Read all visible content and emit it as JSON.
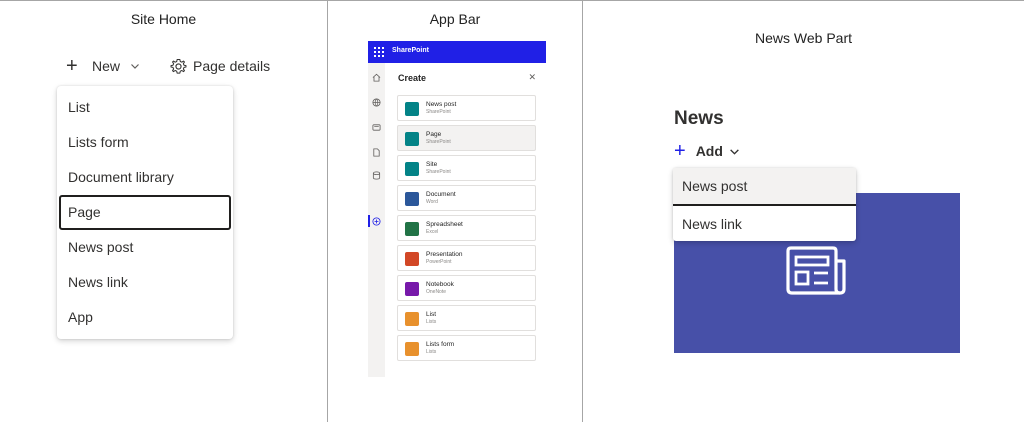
{
  "site_home": {
    "title": "Site Home",
    "new_label": "New",
    "page_details_label": "Page details",
    "menu": [
      "List",
      "Lists form",
      "Document library",
      "Page",
      "News post",
      "News link",
      "App"
    ],
    "selected": "Page"
  },
  "app_bar": {
    "title": "App Bar",
    "brand": "SharePoint",
    "panel_title": "Create",
    "close_glyph": "✕",
    "items": [
      {
        "title": "News post",
        "subtitle": "SharePoint",
        "icon": "sharepoint-news-icon",
        "color": "#038387"
      },
      {
        "title": "Page",
        "subtitle": "SharePoint",
        "icon": "sharepoint-page-icon",
        "color": "#038387"
      },
      {
        "title": "Site",
        "subtitle": "SharePoint",
        "icon": "sharepoint-site-icon",
        "color": "#038387"
      },
      {
        "title": "Document",
        "subtitle": "Word",
        "icon": "word-icon",
        "color": "#2b579a"
      },
      {
        "title": "Spreadsheet",
        "subtitle": "Excel",
        "icon": "excel-icon",
        "color": "#217346"
      },
      {
        "title": "Presentation",
        "subtitle": "PowerPoint",
        "icon": "powerpoint-icon",
        "color": "#d24726"
      },
      {
        "title": "Notebook",
        "subtitle": "OneNote",
        "icon": "onenote-icon",
        "color": "#7719aa"
      },
      {
        "title": "List",
        "subtitle": "Lists",
        "icon": "lists-icon",
        "color": "#e8912d"
      },
      {
        "title": "Lists form",
        "subtitle": "Lists",
        "icon": "lists-form-icon",
        "color": "#e8912d"
      }
    ],
    "highlighted": "Page"
  },
  "news_web_part": {
    "title": "News Web Part",
    "heading": "News",
    "add_label": "Add",
    "menu": [
      "News post",
      "News link"
    ],
    "tile_color": "#4750a8"
  }
}
